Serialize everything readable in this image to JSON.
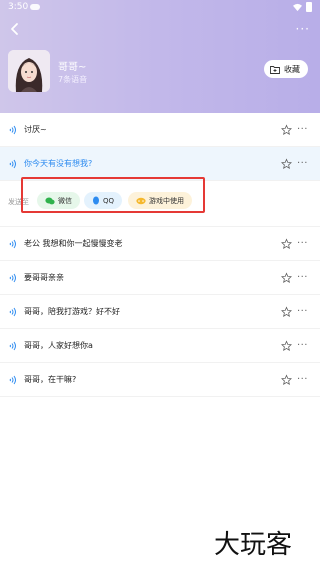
{
  "status_bar": {
    "time": "3:50"
  },
  "header": {
    "title": "哥哥~",
    "subtitle": "7条语音",
    "fav_label": "收藏",
    "more_label": "···"
  },
  "items": [
    {
      "text": "讨厌~"
    },
    {
      "text": "你今天有没有想我?"
    },
    {
      "text": "老公 我想和你一起慢慢变老"
    },
    {
      "text": "要哥哥亲亲"
    },
    {
      "text": "哥哥，陪我打游戏？好不好"
    },
    {
      "text": "哥哥，人家好想你a"
    },
    {
      "text": "哥哥，在干嘛?"
    }
  ],
  "send_to": {
    "label": "发送至",
    "wechat": "微信",
    "qq": "QQ",
    "game": "游戏中使用"
  },
  "row_more": "···",
  "watermark": "大玩客",
  "colors": {
    "accent": "#2d8bf0",
    "highlight": "#e53935",
    "header_start": "#cfc6ea",
    "header_end": "#b8aee8"
  }
}
